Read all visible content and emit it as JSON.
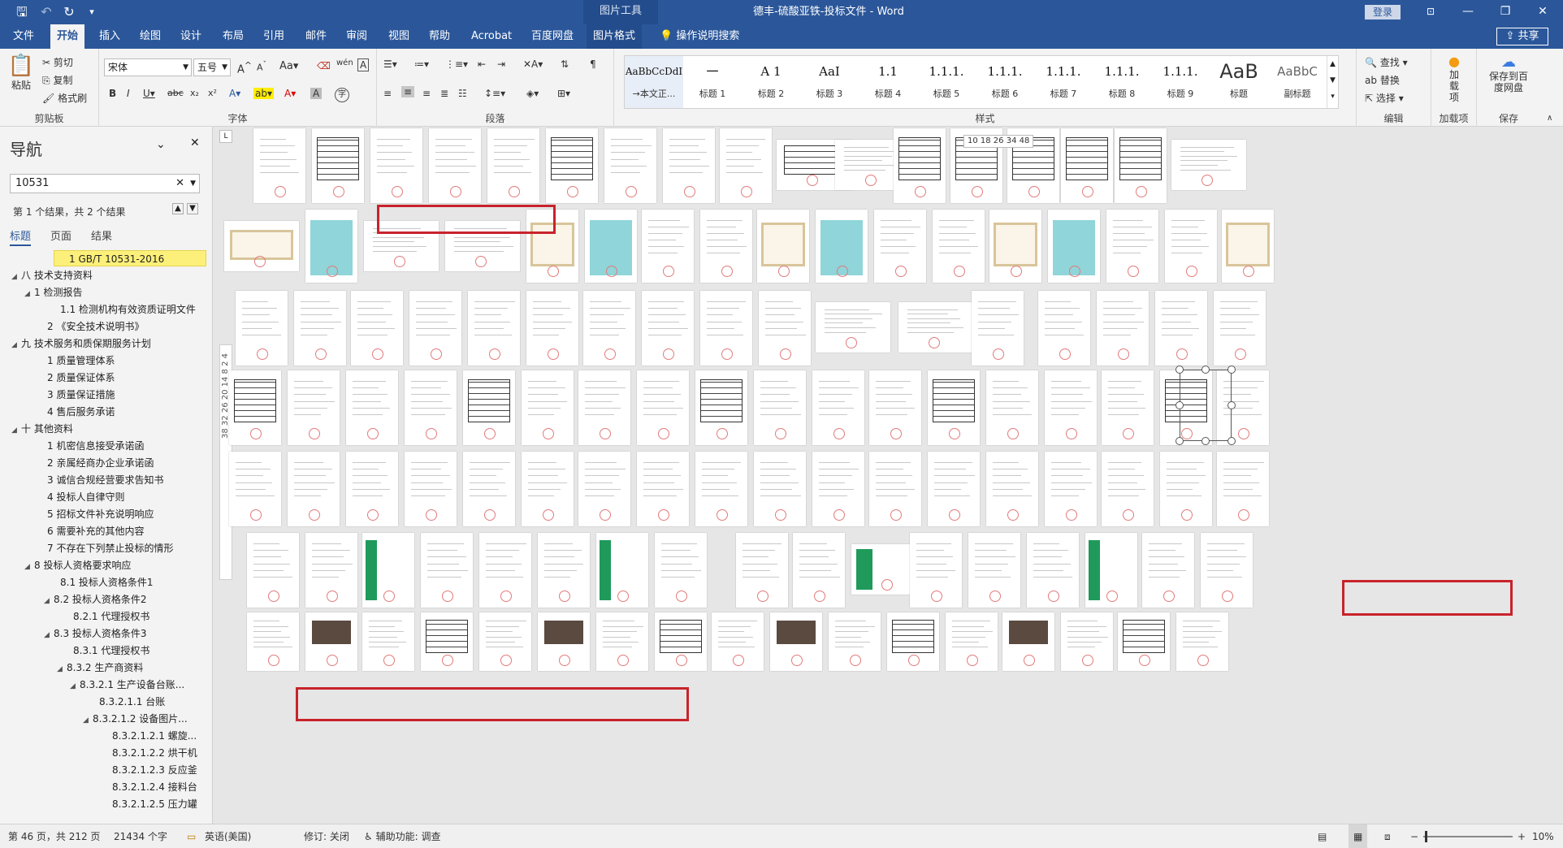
{
  "window": {
    "title": "德丰-硫酸亚铁-投标文件  -  Word",
    "context_tools": "图片工具",
    "login": "登录",
    "controls": [
      "ribbon-display-icon",
      "minimize-icon",
      "restore-icon",
      "close-icon"
    ]
  },
  "tabs": {
    "file": "文件",
    "home": "开始",
    "insert": "插入",
    "draw": "绘图",
    "design": "设计",
    "layout": "布局",
    "references": "引用",
    "mailings": "邮件",
    "review": "审阅",
    "view": "视图",
    "help": "帮助",
    "acrobat": "Acrobat",
    "baidu": "百度网盘",
    "picture_format": "图片格式",
    "tell_me": "操作说明搜索",
    "share": "共享"
  },
  "ribbon": {
    "clipboard": {
      "paste": "粘贴",
      "cut": "剪切",
      "copy": "复制",
      "format_painter": "格式刷",
      "label": "剪贴板"
    },
    "font": {
      "name": "宋体",
      "size": "五号",
      "label": "字体"
    },
    "paragraph": {
      "label": "段落"
    },
    "styles": {
      "label": "样式",
      "items": [
        {
          "preview": "AaBbCcDdI",
          "name": "→本文正..."
        },
        {
          "preview": "一",
          "name": "标题 1"
        },
        {
          "preview": "A 1",
          "name": "标题 2"
        },
        {
          "preview": "AaI",
          "name": "标题 3"
        },
        {
          "preview": "1.1",
          "name": "标题 4"
        },
        {
          "preview": "1.1.1",
          "name": "标题 4"
        },
        {
          "preview": "1.1.1.",
          "name": "标题 5"
        },
        {
          "preview": "1.1.1.",
          "name": "标题 6"
        },
        {
          "preview": "1.1.1.",
          "name": "标题 7"
        },
        {
          "preview": "1.1.1.",
          "name": "标题 8"
        },
        {
          "preview": "1.1.1.",
          "name": "标题 9"
        },
        {
          "preview": "AaB",
          "name": "标题"
        },
        {
          "preview": "AaBbC",
          "name": "副标题"
        }
      ]
    },
    "editing": {
      "find": "查找",
      "replace": "替换",
      "select": "选择",
      "label": "编辑"
    },
    "addins": {
      "load": "加载项",
      "label": "加载项"
    },
    "save": {
      "save_baidu": "保存到百度网盘",
      "label": "保存"
    }
  },
  "nav": {
    "title": "导航",
    "search_value": "10531",
    "results": "第 1 个结果，共 2 个结果",
    "tabs": [
      "标题",
      "页面",
      "结果"
    ],
    "outline": [
      {
        "text": "1 GB/T 10531-2016",
        "level": 2,
        "sel": true,
        "tri": ""
      },
      {
        "text": "八 技术支持资料",
        "level": 0,
        "tri": "◢"
      },
      {
        "text": "1 检测报告",
        "level": 1,
        "tri": "◢"
      },
      {
        "text": "1.1 检测机构有效资质证明文件",
        "level": 3,
        "tri": ""
      },
      {
        "text": "2 《安全技术说明书》",
        "level": 2,
        "tri": ""
      },
      {
        "text": "九 技术服务和质保期服务计划",
        "level": 0,
        "tri": "◢"
      },
      {
        "text": "1 质量管理体系",
        "level": 2,
        "tri": ""
      },
      {
        "text": "2 质量保证体系",
        "level": 2,
        "tri": ""
      },
      {
        "text": "3 质量保证措施",
        "level": 2,
        "tri": ""
      },
      {
        "text": "4 售后服务承诺",
        "level": 2,
        "tri": ""
      },
      {
        "text": "十 其他资料",
        "level": 0,
        "tri": "◢"
      },
      {
        "text": "1 机密信息接受承诺函",
        "level": 2,
        "tri": ""
      },
      {
        "text": "2 亲属经商办企业承诺函",
        "level": 2,
        "tri": ""
      },
      {
        "text": "3 诚信合规经营要求告知书",
        "level": 2,
        "tri": ""
      },
      {
        "text": "4 投标人自律守则",
        "level": 2,
        "tri": ""
      },
      {
        "text": "5 招标文件补充说明响应",
        "level": 2,
        "tri": ""
      },
      {
        "text": "6 需要补充的其他内容",
        "level": 2,
        "tri": ""
      },
      {
        "text": "7 不存在下列禁止投标的情形",
        "level": 2,
        "tri": ""
      },
      {
        "text": "8 投标人资格要求响应",
        "level": 1,
        "tri": "◢"
      },
      {
        "text": "8.1 投标人资格条件1",
        "level": 3,
        "tri": ""
      },
      {
        "text": "8.2 投标人资格条件2",
        "level": 2.5,
        "tri": "◢"
      },
      {
        "text": "8.2.1 代理授权书",
        "level": 4,
        "tri": ""
      },
      {
        "text": "8.3 投标人资格条件3",
        "level": 2.5,
        "tri": "◢"
      },
      {
        "text": "8.3.1 代理授权书",
        "level": 4,
        "tri": ""
      },
      {
        "text": "8.3.2 生产商资料",
        "level": 3.5,
        "tri": "◢"
      },
      {
        "text": "8.3.2.1 生产设备台账...",
        "level": 4.5,
        "tri": "◢"
      },
      {
        "text": "8.3.2.1.1 台账",
        "level": 6,
        "tri": ""
      },
      {
        "text": "8.3.2.1.2 设备图片...",
        "level": 5.5,
        "tri": "◢"
      },
      {
        "text": "8.3.2.1.2.1 螺旋...",
        "level": 7,
        "tri": ""
      },
      {
        "text": "8.3.2.1.2.2 烘干机",
        "level": 7,
        "tri": ""
      },
      {
        "text": "8.3.2.1.2.3 反应釜",
        "level": 7,
        "tri": ""
      },
      {
        "text": "8.3.2.1.2.4 接料台",
        "level": 7,
        "tri": ""
      },
      {
        "text": "8.3.2.1.2.5 压力罐",
        "level": 7,
        "tri": ""
      }
    ]
  },
  "document": {
    "vertical_ruler": "38 32 26 20 14 8 2 4",
    "coord_tip": "10 18 26 34   48"
  },
  "status": {
    "page": "第 46 页，共 212 页",
    "words": "21434 个字",
    "language": "英语(美国)",
    "track": "修订: 关闭",
    "accessibility": "辅助功能: 调查",
    "zoom": "10%"
  },
  "colors": {
    "title_bar": "#2b579a",
    "highlight_box": "#c8232b",
    "stamp": "#e05050"
  }
}
